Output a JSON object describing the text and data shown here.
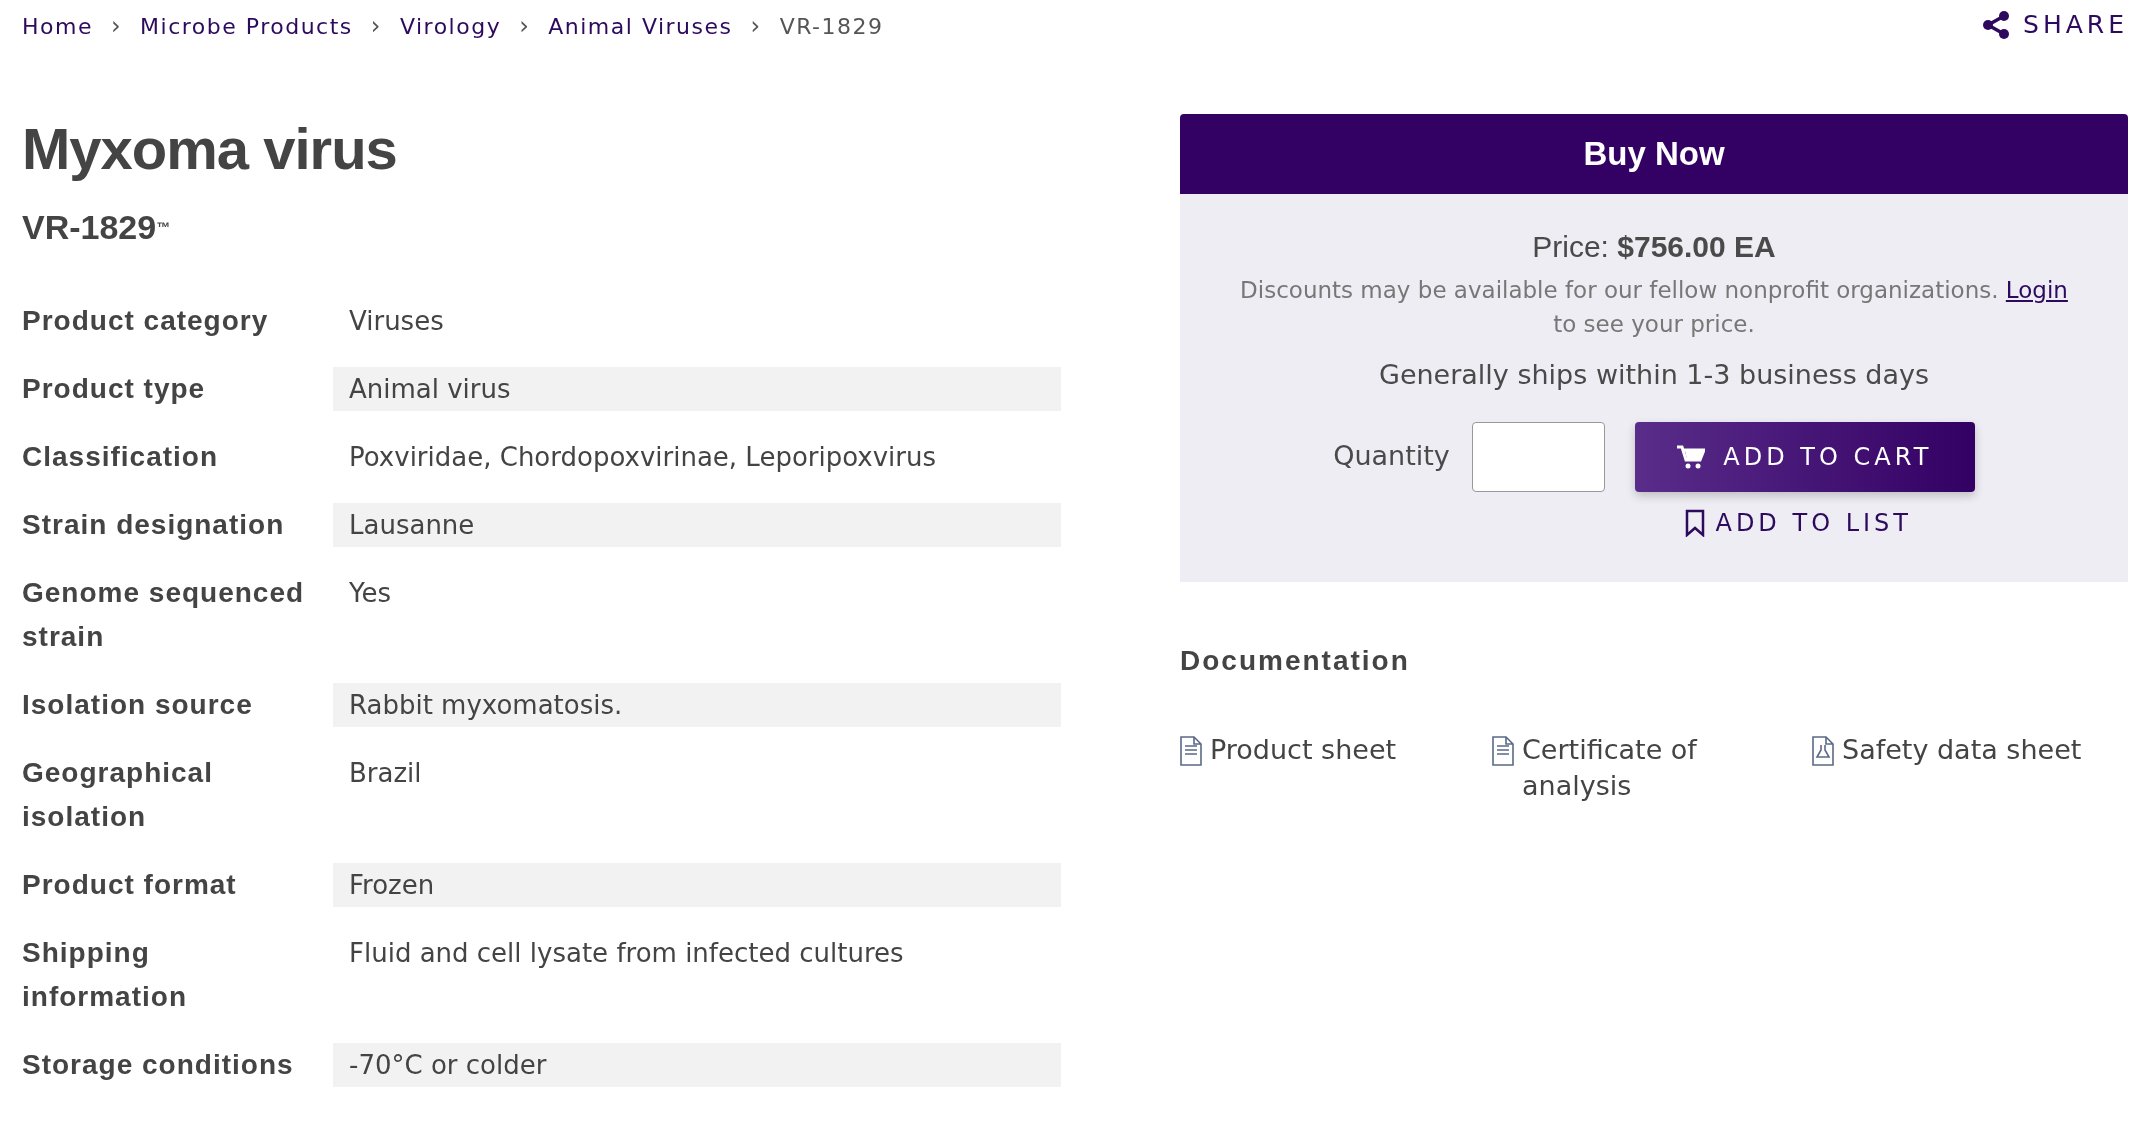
{
  "breadcrumb": [
    {
      "label": "Home",
      "kind": "link"
    },
    {
      "label": "Microbe Products",
      "kind": "link"
    },
    {
      "label": "Virology",
      "kind": "link"
    },
    {
      "label": "Animal Viruses",
      "kind": "link"
    },
    {
      "label": "VR-1829",
      "kind": "current"
    }
  ],
  "breadcrumb_separator": "›",
  "share": {
    "label": "SHARE"
  },
  "product": {
    "title": "Myxoma virus",
    "code": "VR-1829$^{™}$"
  },
  "details": [
    {
      "label": "Product category",
      "value": "Viruses"
    },
    {
      "label": "Product type",
      "value": "Animal virus"
    },
    {
      "label": "Classification",
      "value": "Poxviridae, Chordopoxvirinae, Leporipoxvirus"
    },
    {
      "label": "Strain designation",
      "value": "Lausanne"
    },
    {
      "label": "Genome sequenced strain",
      "value": "Yes"
    },
    {
      "label": "Isolation source",
      "value": "Rabbit myxomatosis."
    },
    {
      "label": "Geographical isolation",
      "value": "Brazil"
    },
    {
      "label": "Product format",
      "value": "Frozen"
    },
    {
      "label": "Shipping information",
      "value": "Fluid and cell lysate from infected cultures"
    },
    {
      "label": "Storage conditions",
      "value": "-70°C or colder"
    }
  ],
  "buy": {
    "title": "Buy Now",
    "price_label": "Price:",
    "price": "$756.00 EA",
    "discount_text": "Discounts may be available for our fellow nonprofit organizations.",
    "login_link": "Login",
    "discount_suffix": "to see your price.",
    "shipping": "Generally ships within 1-3 business days",
    "quantity_label": "Quantity",
    "add_to_cart": "ADD TO CART",
    "add_to_list": "ADD TO LIST"
  },
  "documentation": {
    "title": "Documentation",
    "items": [
      {
        "label": "Product sheet",
        "kind": "document"
      },
      {
        "label": "Certificate of analysis",
        "kind": "document"
      },
      {
        "label": "Safety data sheet",
        "kind": "safety"
      }
    ]
  }
}
